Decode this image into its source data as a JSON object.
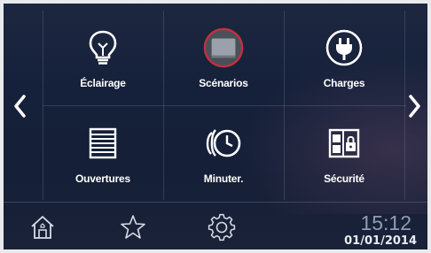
{
  "tiles": [
    {
      "label": "Éclairage",
      "icon": "lightbulb-icon"
    },
    {
      "label": "Scénarios",
      "icon": "scenario-screen-icon"
    },
    {
      "label": "Charges",
      "icon": "plug-icon"
    },
    {
      "label": "Ouvertures",
      "icon": "shutter-icon"
    },
    {
      "label": "Minuter.",
      "icon": "timer-clock-icon"
    },
    {
      "label": "Sécurité",
      "icon": "security-lock-icon"
    }
  ],
  "nav": {
    "prev": "chevron-left-icon",
    "next": "chevron-right-icon"
  },
  "bottom_bar": {
    "home": "home-icon",
    "favorites": "star-icon",
    "settings": "gear-icon"
  },
  "clock": {
    "time": "15:12",
    "date": "01/01/2014"
  },
  "colors": {
    "background": "#15203a",
    "highlight": "#c0323c",
    "text": "#ffffff",
    "time_text": "#8f9db3"
  }
}
